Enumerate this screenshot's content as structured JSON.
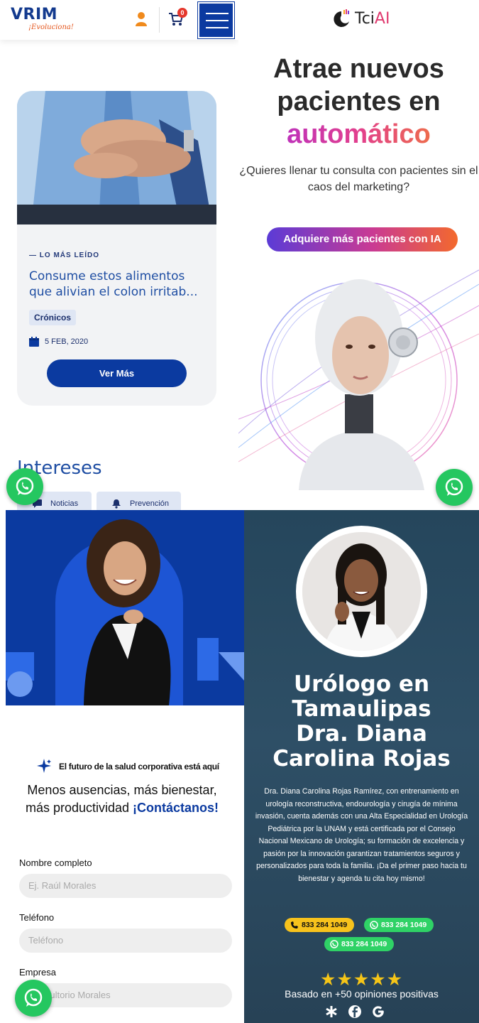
{
  "vrim": {
    "logo": "VRIM",
    "tagline": "¡Evoluciona!",
    "cart_count": "0",
    "card": {
      "label": "— LO MÁS LEÍDO",
      "title": "Consume estos alimentos que alivian el colon irritab...",
      "tag": "Crónicos",
      "date": "5 FEB, 2020",
      "button": "Ver Más"
    },
    "section_title": "Intereses",
    "chips": [
      "Noticias",
      "Prevención"
    ]
  },
  "tcai": {
    "logo_main": "Tci",
    "logo_accent": "AI",
    "headline_line1": "Atrae nuevos",
    "headline_line2": "pacientes en",
    "headline_line3": "automático",
    "subtitle": "¿Quieres llenar tu consulta con pacientes sin el caos del marketing?",
    "cta": "Adquiere más pacientes con IA"
  },
  "corporate": {
    "tagline": "El futuro de la salud corporativa está aquí",
    "headline_a": "Menos ausencias, más bienestar,",
    "headline_b": "más productividad ",
    "headline_cta": "¡Contáctanos!",
    "fields": [
      {
        "label": "Nombre completo",
        "placeholder": "Ej. Raúl Morales"
      },
      {
        "label": "Teléfono",
        "placeholder": "Teléfono"
      },
      {
        "label": "Empresa",
        "placeholder": "Consultorio Morales"
      }
    ]
  },
  "urologist": {
    "title_line1": "Urólogo en",
    "title_line2": "Tamaulipas",
    "title_line3": "Dra. Diana",
    "title_line4": "Carolina Rojas",
    "description": "Dra. Diana Carolina Rojas Ramírez, con entrenamiento en urología reconstructiva, endourología y cirugía de mínima invasión, cuenta además con una Alta Especialidad en Urología Pediátrica por la UNAM y está certificada por el Consejo Nacional Mexicano de Urología; su formación de excelencia y pasión por la innovación garantizan tratamientos seguros y personalizados para toda la familia. ¡Da el primer paso hacia tu bienestar y agenda tu cita hoy mismo!",
    "phone_call": "833 284 1049",
    "phone_whatsapp_1": "833 284 1049",
    "phone_whatsapp_2": "833 284 1049",
    "rating_stars": 5,
    "reviews_text": "Basado en +50 opiniones positivas"
  },
  "colors": {
    "vrim_blue": "#0b3aa0",
    "whatsapp_green": "#25c760",
    "call_yellow": "#f7c21c"
  }
}
